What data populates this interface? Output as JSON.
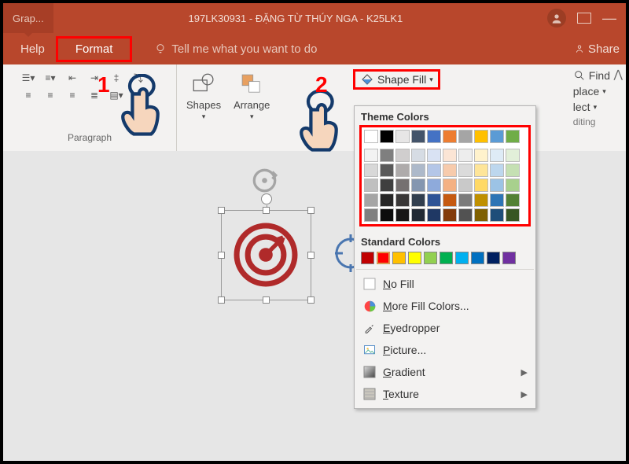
{
  "title": {
    "doc_tab": "Grap...",
    "full_title": "197LK30931 - ĐẶNG TỪ THÚY NGA - K25LK1"
  },
  "menubar": {
    "help": "Help",
    "format": "Format",
    "tell_me": "Tell me what you want to do",
    "share": "Share"
  },
  "ribbon": {
    "paragraph_label": "Paragraph",
    "shapes_label": "Shapes",
    "arrange_label": "Arrange",
    "shape_fill": "Shape Fill",
    "find": "Find",
    "replace_tail": "place",
    "select_tail": "lect",
    "editing_tail": "diting"
  },
  "dropdown": {
    "theme_heading": "Theme Colors",
    "standard_heading": "Standard Colors",
    "no_fill": "No Fill",
    "more_colors": "More Fill Colors...",
    "eyedropper": "Eyedropper",
    "picture": "Picture...",
    "gradient": "Gradient",
    "texture": "Texture"
  },
  "annotations": {
    "one": "1",
    "two": "2"
  },
  "palette": {
    "theme_header": [
      "#ffffff",
      "#000000",
      "#e7e6e6",
      "#44546a",
      "#4472c4",
      "#ed7d31",
      "#a5a5a5",
      "#ffc000",
      "#5b9bd5",
      "#70ad47"
    ],
    "theme_shades": [
      [
        "#f2f2f2",
        "#7f7f7f",
        "#d0cece",
        "#d6dce4",
        "#d9e2f3",
        "#fbe5d5",
        "#ededed",
        "#fff2cc",
        "#deebf6",
        "#e2efd9"
      ],
      [
        "#d8d8d8",
        "#595959",
        "#aeabab",
        "#adb9ca",
        "#b4c6e7",
        "#f7cbac",
        "#dbdbdb",
        "#fee599",
        "#bdd7ee",
        "#c5e0b3"
      ],
      [
        "#bfbfbf",
        "#3f3f3f",
        "#757070",
        "#8496b0",
        "#8eaadb",
        "#f4b183",
        "#c9c9c9",
        "#ffd965",
        "#9cc3e5",
        "#a8d08d"
      ],
      [
        "#a5a5a5",
        "#262626",
        "#3a3838",
        "#323f4f",
        "#2f5496",
        "#c55a11",
        "#7b7b7b",
        "#bf9000",
        "#2e75b5",
        "#538135"
      ],
      [
        "#7f7f7f",
        "#0c0c0c",
        "#171616",
        "#222a35",
        "#1f3864",
        "#833c0b",
        "#525252",
        "#7f6000",
        "#1e4e79",
        "#375623"
      ]
    ],
    "standard": [
      "#c00000",
      "#ff0000",
      "#ffc000",
      "#ffff00",
      "#92d050",
      "#00b050",
      "#00b0f0",
      "#0070c0",
      "#002060",
      "#7030a0"
    ]
  }
}
